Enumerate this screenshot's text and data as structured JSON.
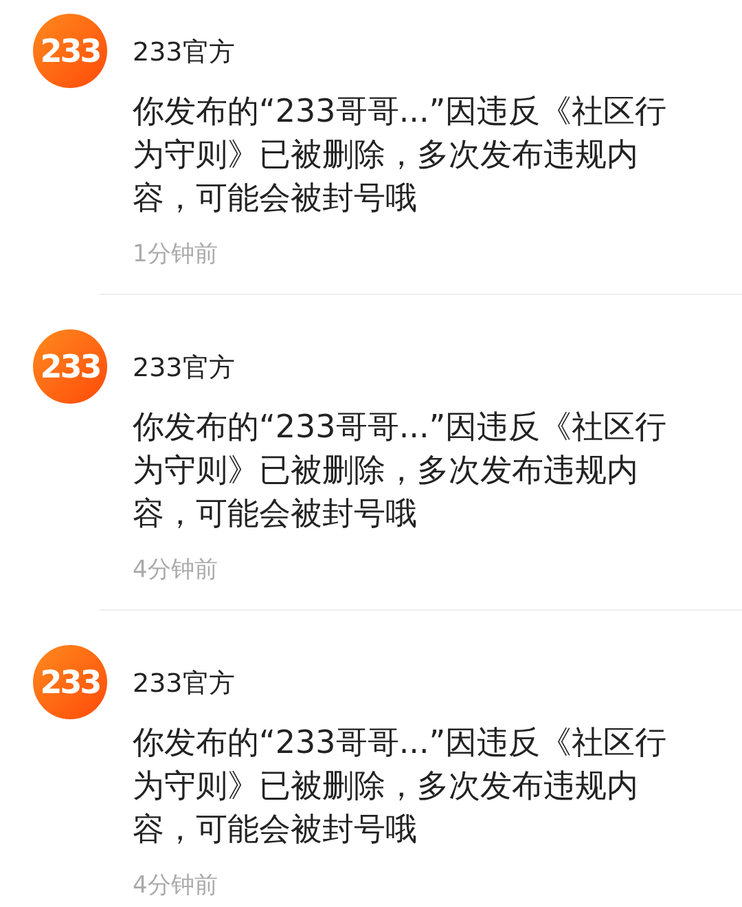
{
  "messages": [
    {
      "avatar": {
        "logo_text": "233"
      },
      "sender": "233官方",
      "text": "你发布的“233哥哥...”因违反《社区行为守则》已被删除，多次发布违规内容，可能会被封号哦",
      "time": "1分钟前"
    },
    {
      "avatar": {
        "logo_text": "233"
      },
      "sender": "233官方",
      "text": "你发布的“233哥哥...”因违反《社区行为守则》已被删除，多次发布违规内容，可能会被封号哦",
      "time": "4分钟前"
    },
    {
      "avatar": {
        "logo_text": "233"
      },
      "sender": "233官方",
      "text": "你发布的“233哥哥...”因违反《社区行为守则》已被删除，多次发布违规内容，可能会被封号哦",
      "time": "4分钟前"
    }
  ]
}
